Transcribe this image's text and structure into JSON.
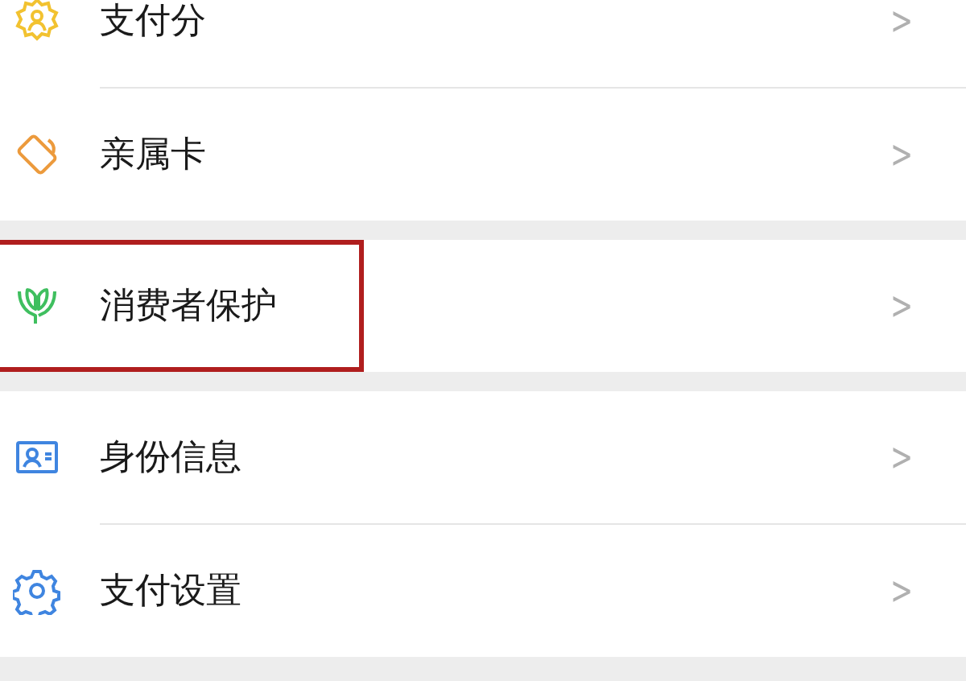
{
  "groups": [
    {
      "items": [
        {
          "label": "支付分",
          "kind": "badge",
          "chevron": ">",
          "highlighted": false
        },
        {
          "label": "亲属卡",
          "kind": "card",
          "chevron": ">",
          "highlighted": false
        }
      ]
    },
    {
      "items": [
        {
          "label": "消费者保护",
          "kind": "hands",
          "chevron": ">",
          "highlighted": true
        }
      ]
    },
    {
      "items": [
        {
          "label": "身份信息",
          "kind": "id",
          "chevron": ">",
          "highlighted": false
        },
        {
          "label": "支付设置",
          "kind": "gear",
          "chevron": ">",
          "highlighted": false
        }
      ]
    }
  ]
}
